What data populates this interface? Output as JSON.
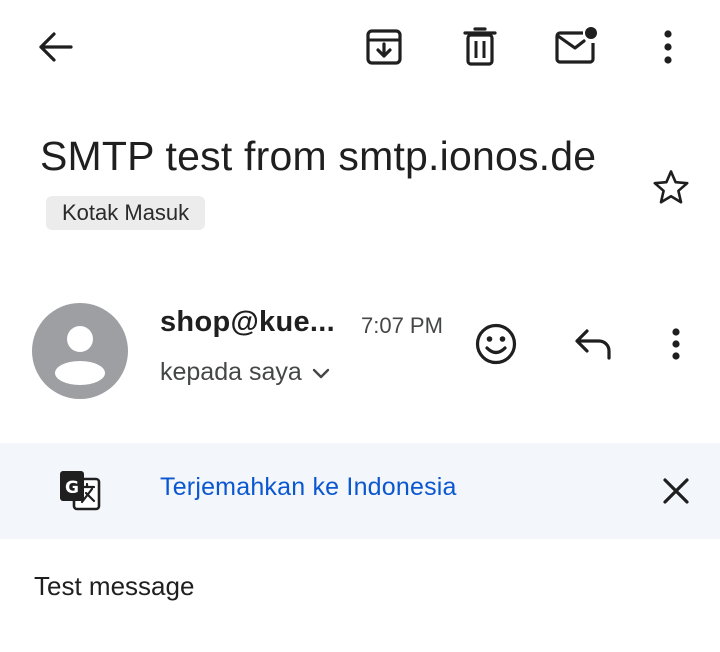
{
  "toolbar": {
    "back_icon": "arrow-back-icon",
    "archive_icon": "archive-icon",
    "delete_icon": "trash-icon",
    "mark_unread_icon": "mark-unread-icon",
    "more_icon": "more-vert-icon"
  },
  "email": {
    "subject": "SMTP test from smtp.ionos.de",
    "label": "Kotak Masuk",
    "starred": false,
    "sender": "shop@kue...",
    "time": "7:07 PM",
    "recipient": "kepada saya",
    "body": "Test message"
  },
  "translate": {
    "link": "Terjemahkan ke Indonesia",
    "icon": "google-translate-icon"
  },
  "colors": {
    "accent_link": "#0b57d0",
    "translate_bg": "#f3f6fb",
    "avatar_bg": "#9e9fa3",
    "chip_bg": "#ececec"
  }
}
